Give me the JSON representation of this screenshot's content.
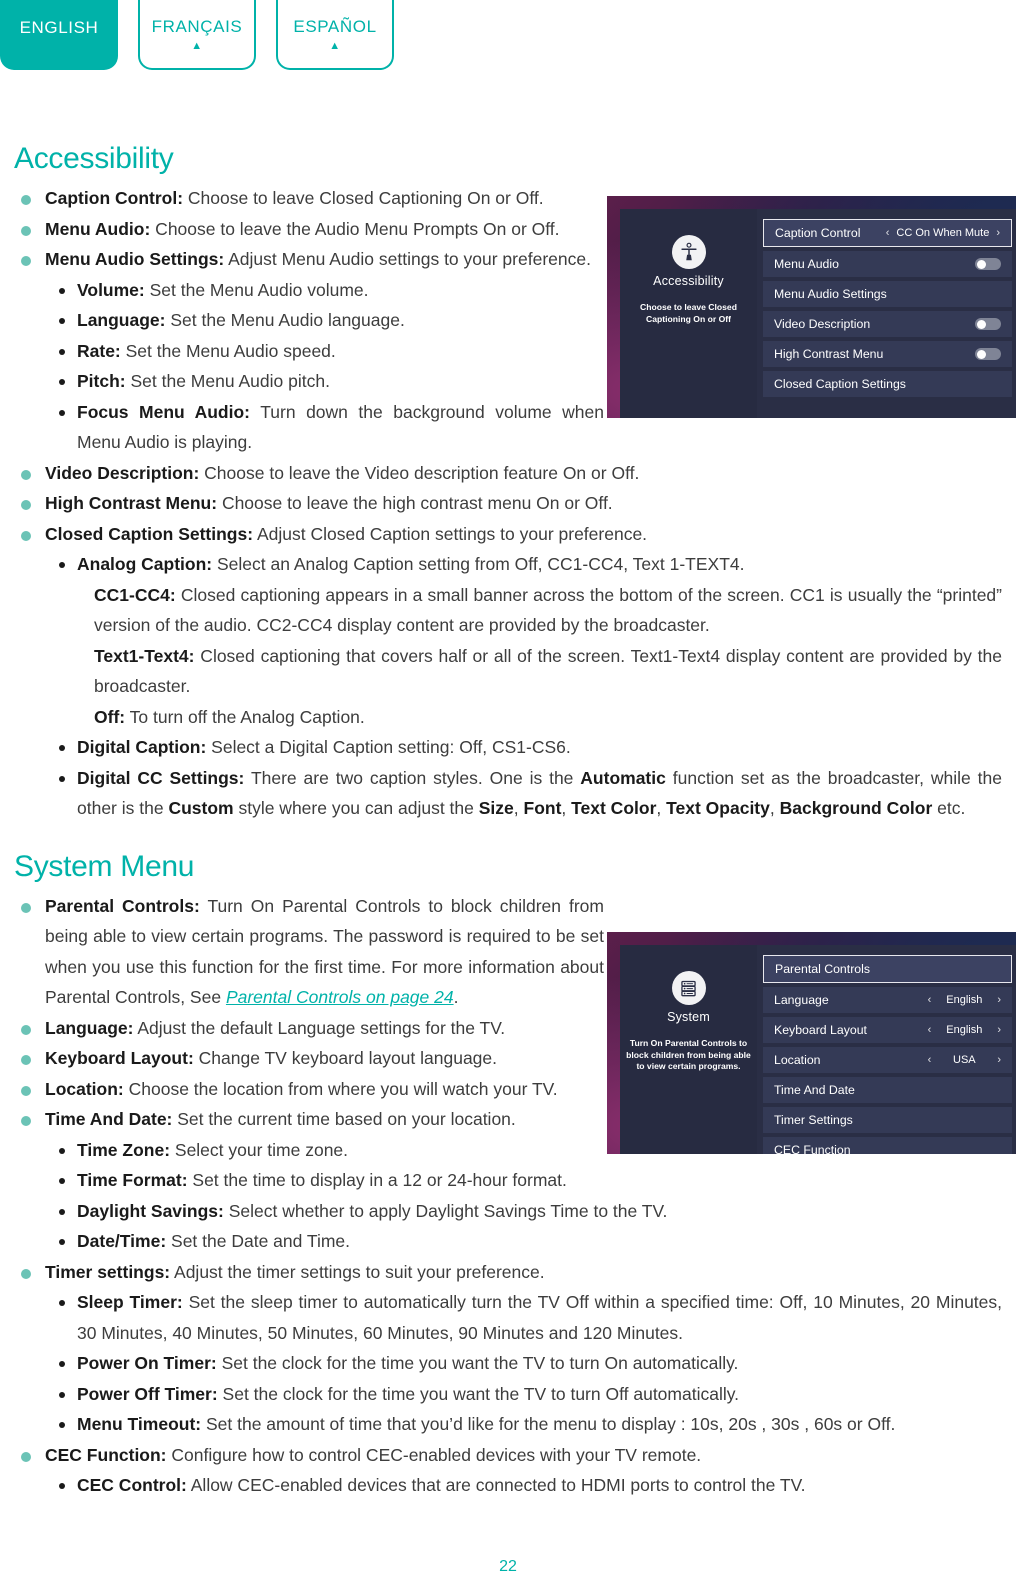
{
  "language_tabs": [
    {
      "label": "ENGLISH",
      "active": true,
      "indicator": "▲"
    },
    {
      "label": "FRANÇAIS",
      "active": false,
      "indicator": "▲"
    },
    {
      "label": "ESPAÑOL",
      "active": false,
      "indicator": "▲"
    }
  ],
  "colors": {
    "accent_teal": "#00b2a9",
    "bullet_teal": "#6bc3b6",
    "body_text": "#3d3d3d",
    "menu_panel": "#2a2e45",
    "menu_row": "#343a56"
  },
  "sections": {
    "accessibility": {
      "heading": "Accessibility",
      "items": {
        "caption_control_b": "Caption Control:",
        "caption_control_t": " Choose to leave Closed Captioning On or Off.",
        "menu_audio_b": "Menu Audio:",
        "menu_audio_t": " Choose to leave the Audio Menu Prompts On or Off.",
        "menu_audio_settings_b": "Menu Audio Settings:",
        "menu_audio_settings_t": " Adjust Menu Audio settings to your preference.",
        "volume_b": "Volume:",
        "volume_t": " Set the Menu Audio volume.",
        "language_b": "Language:",
        "language_t": " Set the Menu Audio language.",
        "rate_b": "Rate:",
        "rate_t": " Set the Menu Audio speed.",
        "pitch_b": "Pitch:",
        "pitch_t": " Set the Menu Audio pitch.",
        "focus_menu_audio_b": "Focus Menu Audio:",
        "focus_menu_audio_t": " Turn down the background volume when Menu Audio is playing.",
        "video_description_b": "Video Description:",
        "video_description_t": " Choose to leave the Video description feature On or Off.",
        "high_contrast_b": "High Contrast Menu:",
        "high_contrast_t": " Choose to leave the high contrast menu On or Off.",
        "closed_caption_settings_b": "Closed Caption Settings:",
        "closed_caption_settings_t": " Adjust Closed Caption settings to your preference.",
        "analog_caption_b": "Analog Caption:",
        "analog_caption_t": " Select an Analog Caption setting from Off, CC1-CC4, Text 1-TEXT4.",
        "cc1cc4_b": "CC1-CC4:",
        "cc1cc4_t": " Closed captioning appears in a small banner across the bottom of the screen. CC1 is usually the “printed” version of the audio. CC2-CC4 display content are provided by the broadcaster.",
        "text1text4_b": "Text1-Text4:",
        "text1text4_t": " Closed captioning that covers half or all of the screen. Text1-Text4 display content are provided by the broadcaster.",
        "off_b": "Off:",
        "off_t": " To turn off the Analog Caption.",
        "digital_caption_b": "Digital Caption:",
        "digital_caption_t": " Select a Digital Caption setting: Off, CS1-CS6.",
        "digital_cc_b": "Digital CC Settings:",
        "digital_cc_t1": " There are two caption styles. One is the ",
        "digital_cc_auto": "Automatic",
        "digital_cc_t2": " function set as the broadcaster, while the other is the ",
        "digital_cc_custom": "Custom",
        "digital_cc_t3": " style where you can adjust the ",
        "digital_cc_size": "Size",
        "digital_cc_sep1": ", ",
        "digital_cc_font": "Font",
        "digital_cc_sep2": ", ",
        "digital_cc_textcolor": "Text Color",
        "digital_cc_sep3": ", ",
        "digital_cc_textopacity": "Text Opacity",
        "digital_cc_sep4": ", ",
        "digital_cc_bgcolor": "Background Color",
        "digital_cc_t4": " etc."
      }
    },
    "system_menu": {
      "heading": "System Menu",
      "items": {
        "parental_controls_b": "Parental Controls:",
        "parental_controls_t1": " Turn On Parental Controls to block children from being able to view certain programs. The password is required to be set when you use this function for the first time. For more information about Parental Controls, See ",
        "parental_controls_link": "Parental Controls on page 24",
        "parental_controls_t2": ".",
        "language_b": "Language:",
        "language_t": " Adjust the default Language settings for the TV.",
        "keyboard_layout_b": "Keyboard Layout:",
        "keyboard_layout_t": "  Change TV keyboard layout language.",
        "location_b": "Location:",
        "location_t": " Choose the location from where you will watch your TV.",
        "time_and_date_b": "Time And Date:",
        "time_and_date_t": " Set the current time based on your location.",
        "time_zone_b": "Time Zone:",
        "time_zone_t": " Select your time zone.",
        "time_format_b": "Time Format:",
        "time_format_t": " Set the time to display in a 12 or 24-hour format.",
        "daylight_savings_b": "Daylight Savings:",
        "daylight_savings_t": " Select whether to apply Daylight Savings Time to the TV.",
        "date_time_b": "Date/Time:",
        "date_time_t": " Set the Date and Time.",
        "timer_settings_b": "Timer settings:",
        "timer_settings_t": " Adjust the timer settings to suit your preference.",
        "sleep_timer_b": "Sleep Timer:",
        "sleep_timer_t": " Set the sleep timer to automatically turn the TV Off within a specified time: Off, 10 Minutes, 20 Minutes, 30 Minutes, 40 Minutes, 50 Minutes, 60 Minutes, 90 Minutes and 120 Minutes.",
        "power_on_timer_b": "Power On Timer:",
        "power_on_timer_t": " Set the clock for the time you want the TV to turn On automatically.",
        "power_off_timer_b": "Power Off Timer:",
        "power_off_timer_t": " Set the clock for the time you want the TV to turn Off automatically.",
        "menu_timeout_b": "Menu Timeout:",
        "menu_timeout_t": " Set the amount of time that you’d like for the menu to display : 10s, 20s , 30s , 60s or Off.",
        "cec_function_b": "CEC Function:",
        "cec_function_t": " Configure how to control CEC-enabled devices with your TV remote.",
        "cec_control_b": "CEC Control:",
        "cec_control_t": " Allow CEC-enabled devices that are connected to HDMI ports to control the TV."
      }
    }
  },
  "tv_screenshot_accessibility": {
    "icon": "accessibility-person-icon",
    "panel_title": "Accessibility",
    "panel_description": "Choose to leave Closed Captioning On or Off",
    "rows": [
      {
        "label": "Caption Control",
        "selected": true,
        "control": "value",
        "value": "CC On When Mute",
        "left_chevron": "‹",
        "right_chevron": "›"
      },
      {
        "label": "Menu Audio",
        "selected": false,
        "control": "toggle",
        "toggle_state": "off"
      },
      {
        "label": "Menu Audio Settings",
        "selected": false,
        "control": "none"
      },
      {
        "label": "Video Description",
        "selected": false,
        "control": "toggle",
        "toggle_state": "off"
      },
      {
        "label": "High Contrast Menu",
        "selected": false,
        "control": "toggle",
        "toggle_state": "off"
      },
      {
        "label": "Closed Caption Settings",
        "selected": false,
        "control": "none"
      }
    ]
  },
  "tv_screenshot_system": {
    "icon": "system-server-icon",
    "panel_title": "System",
    "panel_description": "Turn On Parental Controls to block children from being able to view certain programs.",
    "rows": [
      {
        "label": "Parental Controls",
        "selected": true,
        "control": "none"
      },
      {
        "label": "Language",
        "selected": false,
        "control": "value",
        "value": "English",
        "left_chevron": "‹",
        "right_chevron": "›"
      },
      {
        "label": "Keyboard Layout",
        "selected": false,
        "control": "value",
        "value": "English",
        "left_chevron": "‹",
        "right_chevron": "›"
      },
      {
        "label": "Location",
        "selected": false,
        "control": "value",
        "value": "USA",
        "left_chevron": "‹",
        "right_chevron": "›"
      },
      {
        "label": "Time And Date",
        "selected": false,
        "control": "none"
      },
      {
        "label": "Timer Settings",
        "selected": false,
        "control": "none"
      },
      {
        "label": "CEC Function",
        "selected": false,
        "control": "none"
      }
    ]
  },
  "page_number": "22"
}
